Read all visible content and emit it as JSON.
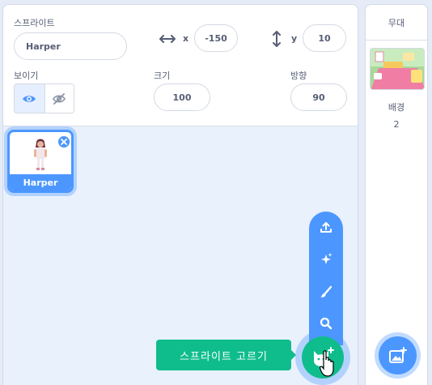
{
  "sprite_info": {
    "sprite_label": "스프라이트",
    "sprite_name": "Harper",
    "x_label": "x",
    "x_value": "-150",
    "y_label": "y",
    "y_value": "10",
    "show_label": "보이기",
    "size_label": "크기",
    "size_value": "100",
    "direction_label": "방향",
    "direction_value": "90"
  },
  "sprites": [
    {
      "name": "Harper",
      "selected": true
    }
  ],
  "add_sprite": {
    "tooltip": "스프라이트 고르기",
    "menu_icons": [
      "upload-icon",
      "surprise-icon",
      "paint-icon",
      "search-icon"
    ],
    "main_icon": "cat-plus-icon"
  },
  "stage": {
    "title": "무대",
    "backdrops_label": "배경",
    "backdrop_count": "2"
  },
  "colors": {
    "accent_blue": "#4c97ff",
    "green": "#0fbd8c",
    "text": "#575e75"
  }
}
